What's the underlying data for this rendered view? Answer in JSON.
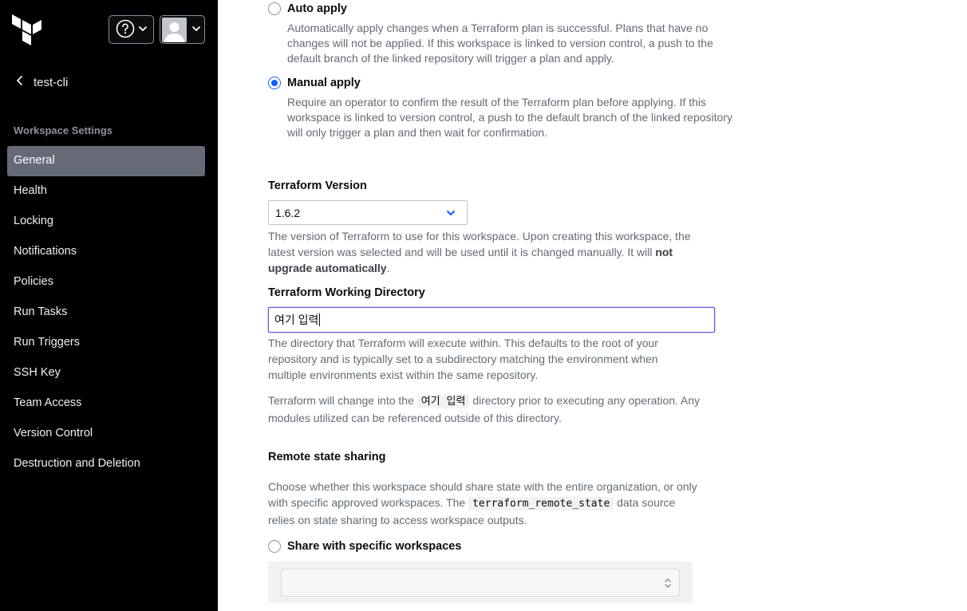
{
  "sidebar": {
    "back_label": "test-cli",
    "section_label": "Workspace Settings",
    "items": [
      {
        "label": "General",
        "active": true
      },
      {
        "label": "Health"
      },
      {
        "label": "Locking"
      },
      {
        "label": "Notifications"
      },
      {
        "label": "Policies"
      },
      {
        "label": "Run Tasks"
      },
      {
        "label": "Run Triggers"
      },
      {
        "label": "SSH Key"
      },
      {
        "label": "Team Access"
      },
      {
        "label": "Version Control"
      },
      {
        "label": "Destruction and Deletion"
      }
    ]
  },
  "apply_method": {
    "auto": {
      "label": "Auto apply",
      "selected": false,
      "description": "Automatically apply changes when a Terraform plan is successful. Plans that have no changes will not be applied. If this workspace is linked to version control, a push to the default branch of the linked repository will trigger a plan and apply."
    },
    "manual": {
      "label": "Manual apply",
      "selected": true,
      "description": "Require an operator to confirm the result of the Terraform plan before applying. If this workspace is linked to version control, a push to the default branch of the linked repository will only trigger a plan and then wait for confirmation."
    }
  },
  "terraform_version": {
    "label": "Terraform Version",
    "value": "1.6.2",
    "help_prefix": "The version of Terraform to use for this workspace. Upon creating this workspace, the latest version was selected and will be used until it is changed manually. It will ",
    "help_bold": "not upgrade automatically",
    "help_suffix": "."
  },
  "working_directory": {
    "label": "Terraform Working Directory",
    "value": "여기 입력",
    "help": "The directory that Terraform will execute within. This defaults to the root of your repository and is typically set to a subdirectory matching the environment when multiple environments exist within the same repository.",
    "note_prefix": "Terraform will change into the ",
    "note_code": "여기 입력",
    "note_suffix": " directory prior to executing any operation. Any modules utilized can be referenced outside of this directory."
  },
  "remote_state": {
    "heading": "Remote state sharing",
    "help_prefix": "Choose whether this workspace should share state with the entire organization, or only with specific approved workspaces. The ",
    "help_code": "terraform_remote_state",
    "help_suffix": " data source relies on state sharing to access workspace outputs.",
    "specific_label": "Share with specific workspaces",
    "specific_selected": false
  },
  "colors": {
    "sidebar_bg": "#000000",
    "active_nav": "#656a76",
    "accent": "#1060ff",
    "focus": "#6b50e6"
  },
  "icons": [
    "terraform-logo-icon",
    "help-icon",
    "chevron-down-icon",
    "avatar-icon",
    "chevron-left-icon",
    "select-chevron-icon",
    "updown-icon"
  ]
}
